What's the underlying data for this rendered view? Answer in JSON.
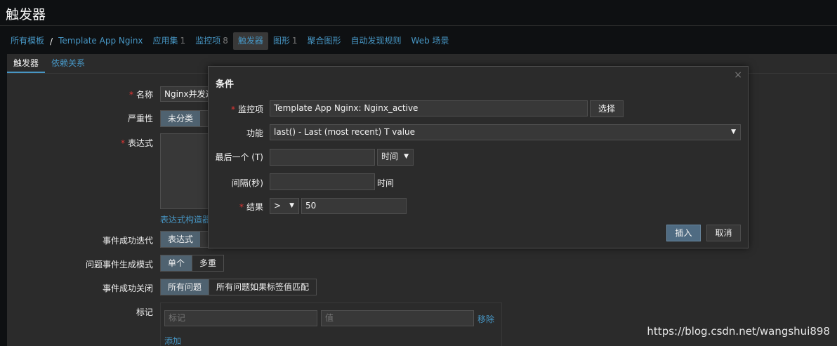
{
  "page": {
    "title": "触发器"
  },
  "breadcrumb": [
    {
      "label": "所有模板",
      "count": ""
    },
    {
      "label": "Template App Nginx",
      "count": ""
    },
    {
      "label": "应用集",
      "count": "1"
    },
    {
      "label": "监控项",
      "count": "8"
    },
    {
      "label": "触发器",
      "count": ""
    },
    {
      "label": "图形",
      "count": "1"
    },
    {
      "label": "聚合图形",
      "count": ""
    },
    {
      "label": "自动发现规则",
      "count": ""
    },
    {
      "label": "Web 场景",
      "count": ""
    }
  ],
  "breadcrumb_sep": "/",
  "tabs": [
    "触发器",
    "依赖关系"
  ],
  "form": {
    "name_label": "名称",
    "name_value": "Nginx并发过",
    "severity_label": "严重性",
    "severity_value": "未分类",
    "expression_label": "表达式",
    "expression_builder": "表达式构造器",
    "ok_event_gen_label": "事件成功迭代",
    "ok_event_gen_value": "表达式",
    "problem_mode_label": "问题事件生成模式",
    "problem_mode_options": [
      "单个",
      "多重"
    ],
    "ok_close_label": "事件成功关闭",
    "ok_close_options": [
      "所有问题",
      "所有问题如果标签值匹配"
    ],
    "tags_label": "标记",
    "tag_placeholder": "标记",
    "value_placeholder": "值",
    "remove_link": "移除",
    "add_link": "添加"
  },
  "dialog": {
    "title": "条件",
    "close": "×",
    "item_label": "监控项",
    "item_value": "Template App Nginx: Nginx_active",
    "select_button": "选择",
    "function_label": "功能",
    "function_value": "last() - Last (most recent) T value",
    "last_label": "最后一个 (T)",
    "last_value": "",
    "last_unit": "时间",
    "shift_label": "间隔(秒)",
    "shift_value": "",
    "shift_unit": "时间",
    "result_label": "结果",
    "result_operator": ">",
    "result_value": "50",
    "insert_button": "插入",
    "cancel_button": "取消"
  },
  "watermark": "https://blog.csdn.net/wangshui898",
  "colors": {
    "background": "#0e1012",
    "panel": "#2b2b2b",
    "link": "#4796c4",
    "required": "#e33734",
    "primary_button": "#4f6b82"
  }
}
